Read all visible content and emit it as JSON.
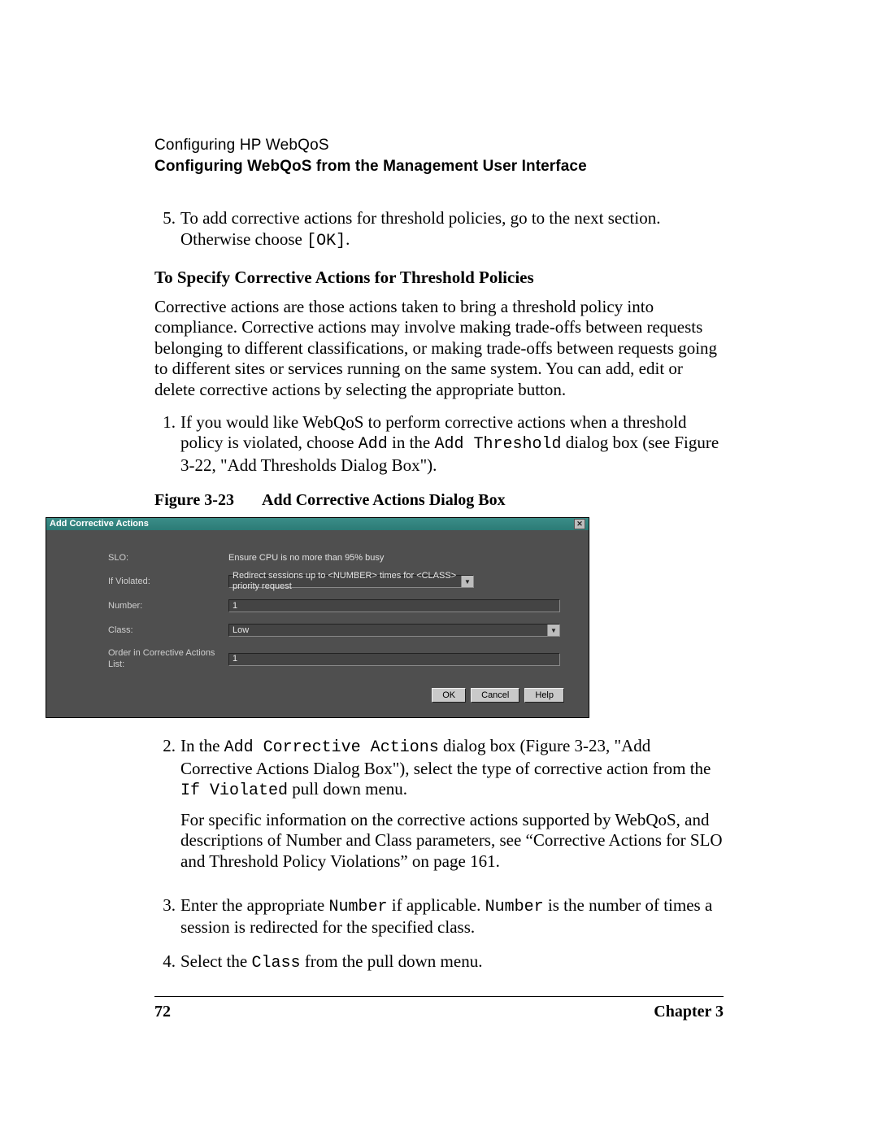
{
  "header": {
    "light": "Configuring HP WebQoS",
    "bold": "Configuring WebQoS from the Management User Interface"
  },
  "step5": {
    "num": "5.",
    "text_a": "To add corrective actions for threshold policies, go to the next section. Otherwise choose ",
    "mono": "[OK]",
    "text_b": "."
  },
  "sub_heading": "To Specify Corrective Actions for Threshold Policies",
  "intro_para": "Corrective actions are those actions taken to bring a threshold policy into compliance. Corrective actions may involve making trade-offs between requests belonging to different classifications, or making trade-offs between requests going to different sites or services running on the same system. You can add, edit or delete corrective actions by selecting the appropriate button.",
  "step1": {
    "num": "1.",
    "a": "If you would like WebQoS to perform corrective actions when a threshold policy is violated, choose ",
    "m1": "Add",
    "b": " in the ",
    "m2": "Add Threshold",
    "c": " dialog box (see Figure 3-22, \"Add Thresholds Dialog Box\")."
  },
  "figure": {
    "num": "Figure 3-23",
    "title": "Add Corrective Actions Dialog Box"
  },
  "dialog": {
    "title": "Add Corrective Actions",
    "labels": {
      "slo": "SLO:",
      "ifv": "If Violated:",
      "number": "Number:",
      "class": "Class:",
      "order": "Order in Corrective Actions List:"
    },
    "values": {
      "slo": "Ensure CPU is no more than 95% busy",
      "ifv": "Redirect sessions up to <NUMBER> times for <CLASS> priority request",
      "number": "1",
      "class": "Low",
      "order": "1"
    },
    "buttons": {
      "ok": "OK",
      "cancel": "Cancel",
      "help": "Help"
    }
  },
  "step2": {
    "num": "2.",
    "a": "In the ",
    "m1": "Add Corrective Actions",
    "b": " dialog box (Figure 3-23, \"Add Corrective Actions Dialog Box\"), select the type of corrective action from the ",
    "m2": "If Violated",
    "c": " pull down menu."
  },
  "step2_para": "For specific information on the corrective actions supported by WebQoS, and descriptions of Number and Class parameters, see “Corrective Actions for SLO and Threshold Policy Violations” on page 161.",
  "step3": {
    "num": "3.",
    "a": "Enter the appropriate ",
    "m1": "Number",
    "b": " if applicable. ",
    "m2": "Number",
    "c": " is the number of times a session is redirected for the specified class."
  },
  "step4": {
    "num": "4.",
    "a": "Select the ",
    "m1": "Class",
    "b": " from the pull down menu."
  },
  "footer": {
    "page": "72",
    "chapter": "Chapter 3"
  }
}
